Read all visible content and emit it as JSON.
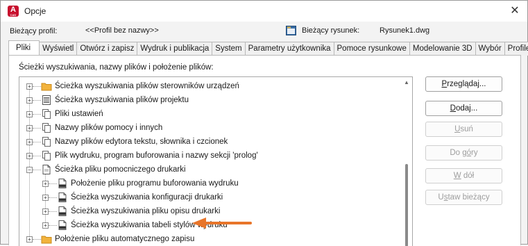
{
  "window": {
    "title": "Opcje",
    "app_icon_letter": "A",
    "app_icon_sub": "CAD"
  },
  "profile": {
    "label": "Bieżący profil:",
    "value": "<<Profil bez nazwy>>",
    "drawing_label": "Bieżący rysunek:",
    "drawing_value": "Rysunek1.dwg"
  },
  "tabs": [
    {
      "label": "Pliki",
      "active": true
    },
    {
      "label": "Wyświetl"
    },
    {
      "label": "Otwórz i zapisz"
    },
    {
      "label": "Wydruk i publikacja"
    },
    {
      "label": "System"
    },
    {
      "label": "Parametry użytkownika"
    },
    {
      "label": "Pomoce rysunkowe"
    },
    {
      "label": "Modelowanie 3D"
    },
    {
      "label": "Wybór"
    },
    {
      "label": "Profile"
    }
  ],
  "panel": {
    "label": "Ścieżki wyszukiwania, nazwy plików i położenie plików:",
    "tree": [
      {
        "label": "Ścieżka wyszukiwania plików sterowników urządzeń",
        "icon": "folder-icon",
        "level": 0,
        "expander": "+"
      },
      {
        "label": "Ścieżka wyszukiwania plików projektu",
        "icon": "project-file-icon",
        "level": 0,
        "expander": "+"
      },
      {
        "label": "Pliki ustawień",
        "icon": "files-icon",
        "level": 0,
        "expander": "+"
      },
      {
        "label": "Nazwy plików pomocy i innych",
        "icon": "files-icon",
        "level": 0,
        "expander": "+"
      },
      {
        "label": "Nazwy plików edytora tekstu, słownika i czcionek",
        "icon": "files-icon",
        "level": 0,
        "expander": "+"
      },
      {
        "label": "Plik wydruku, program buforowania i nazwy sekcji 'prolog'",
        "icon": "files-icon",
        "level": 0,
        "expander": "+"
      },
      {
        "label": "Ścieżka pliku pomocniczego drukarki",
        "icon": "document-icon",
        "level": 0,
        "expander": "-"
      },
      {
        "label": "Położenie pliku programu buforowania wydruku",
        "icon": "plt-file-icon",
        "level": 1,
        "expander": "+"
      },
      {
        "label": "Ścieżka wyszukiwania konfiguracji drukarki",
        "icon": "plt-file-icon",
        "level": 1,
        "expander": "+"
      },
      {
        "label": "Ścieżka wyszukiwania pliku opisu drukarki",
        "icon": "plt-file-icon",
        "level": 1,
        "expander": "+"
      },
      {
        "label": "Ścieżka wyszukiwania tabeli stylów wydruku",
        "icon": "plt-file-icon",
        "level": 1,
        "expander": "+"
      },
      {
        "label": "Położenie pliku automatycznego zapisu",
        "icon": "folder-icon",
        "level": 0,
        "expander": "+"
      }
    ]
  },
  "buttons": {
    "browse": {
      "prefix": "",
      "accel": "P",
      "suffix": "rzeglądaj...",
      "enabled": true
    },
    "add": {
      "prefix": "",
      "accel": "D",
      "suffix": "odaj...",
      "enabled": true
    },
    "remove": {
      "prefix": "",
      "accel": "U",
      "suffix": "suń",
      "enabled": false
    },
    "move_up": {
      "prefix": "Do g",
      "accel": "ó",
      "suffix": "ry",
      "enabled": false
    },
    "move_down": {
      "prefix": "",
      "accel": "W",
      "suffix": " dół",
      "enabled": false
    },
    "set_current": {
      "prefix": "U",
      "accel": "s",
      "suffix": "taw bieżący",
      "enabled": false
    }
  },
  "colors": {
    "arrow": "#e8752a",
    "folder": "#f2b33d",
    "app_icon": "#c8102e"
  }
}
